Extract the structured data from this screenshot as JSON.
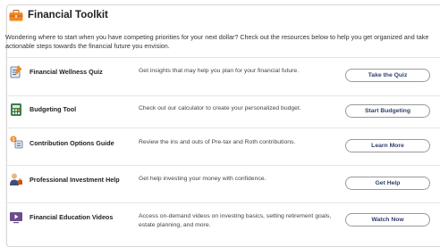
{
  "header": {
    "title": "Financial Toolkit"
  },
  "intro": "Wondering where to start when you have competing priorities for your next dollar? Check out the resources below to help you get organized and take actionable steps towards the financial future you envision.",
  "rows": [
    {
      "title": "Financial Wellness Quiz",
      "desc": "Get insights that may help you plan for your financial future.",
      "button": "Take the Quiz",
      "icon": "quiz-icon"
    },
    {
      "title": "Budgeting Tool",
      "desc": "Check out our calculator to create your personalized budget.",
      "button": "Start Budgeting",
      "icon": "calculator-icon"
    },
    {
      "title": "Contribution Options Guide",
      "desc": "Review the ins and outs of Pre-tax and Roth contributions.",
      "button": "Learn More",
      "icon": "guide-icon"
    },
    {
      "title": "Professional Investment Help",
      "desc": "Get help investing your money with confidence.",
      "button": "Get Help",
      "icon": "advisor-icon"
    },
    {
      "title": "Financial Education Videos",
      "desc": "Access on-demand videos on investing basics, setting retirement goals, estate planning, and more.",
      "button": "Watch Now",
      "icon": "video-icon"
    }
  ],
  "colors": {
    "accent": "#f08a24",
    "button_text": "#2f3f6e",
    "border": "#9a9a9a"
  }
}
